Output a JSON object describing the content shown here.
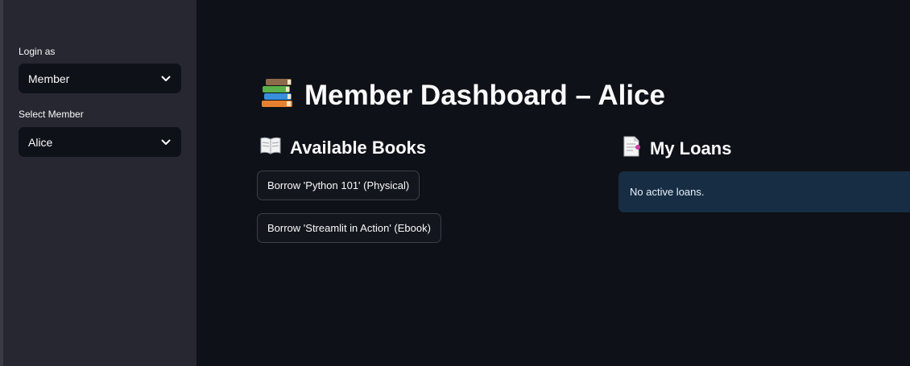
{
  "sidebar": {
    "login_label": "Login as",
    "login_value": "Member",
    "member_label": "Select Member",
    "member_value": "Alice"
  },
  "main": {
    "title_icon": "books-icon",
    "title": "Member Dashboard – Alice",
    "available_heading_icon": "open-book-icon",
    "available_heading": "Available Books",
    "buttons": [
      "Borrow 'Python 101' (Physical)",
      "Borrow 'Streamlit in Action' (Ebook)"
    ],
    "loans_heading_icon": "page-icon",
    "loans_heading": "My Loans",
    "loans_info": "No active loans."
  },
  "colors": {
    "background": "#0e1117",
    "sidebar": "#262730",
    "info_box": "#172d43"
  }
}
